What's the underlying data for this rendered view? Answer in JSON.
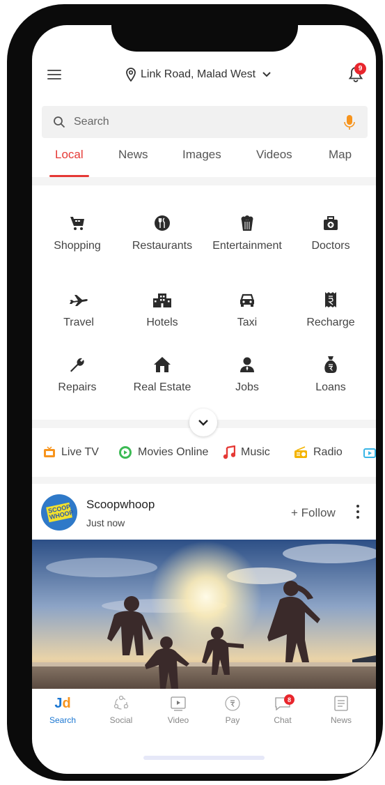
{
  "header": {
    "location": "Link Road, Malad West",
    "notification_count": "9"
  },
  "search": {
    "placeholder": "Search"
  },
  "tabs": [
    {
      "label": "Local"
    },
    {
      "label": "News"
    },
    {
      "label": "Images"
    },
    {
      "label": "Videos"
    },
    {
      "label": "Map"
    }
  ],
  "categories": [
    {
      "label": "Shopping",
      "icon": "shopping-cart-icon"
    },
    {
      "label": "Restaurants",
      "icon": "restaurant-icon"
    },
    {
      "label": "Entertainment",
      "icon": "popcorn-icon"
    },
    {
      "label": "Doctors",
      "icon": "medical-kit-icon"
    },
    {
      "label": "Travel",
      "icon": "airplane-icon"
    },
    {
      "label": "Hotels",
      "icon": "hotel-icon"
    },
    {
      "label": "Taxi",
      "icon": "taxi-icon"
    },
    {
      "label": "Recharge",
      "icon": "receipt-icon"
    },
    {
      "label": "Repairs",
      "icon": "wrench-icon"
    },
    {
      "label": "Real Estate",
      "icon": "house-icon"
    },
    {
      "label": "Jobs",
      "icon": "person-icon"
    },
    {
      "label": "Loans",
      "icon": "money-bag-icon"
    }
  ],
  "media": [
    {
      "label": "Live TV",
      "icon": "tv-icon",
      "color": "#f7941d"
    },
    {
      "label": "Movies Online",
      "icon": "play-circle-icon",
      "color": "#3cba54"
    },
    {
      "label": "Music",
      "icon": "music-note-icon",
      "color": "#e53935"
    },
    {
      "label": "Radio",
      "icon": "radio-icon",
      "color": "#f4b400"
    }
  ],
  "post": {
    "logo_text": "SCOOP WHOOP",
    "name": "Scoopwhoop",
    "time": "Just now",
    "follow_label": "+ Follow"
  },
  "bottom_nav": [
    {
      "label": "Search",
      "logo": "Jd",
      "icon": "jd-logo-icon"
    },
    {
      "label": "Social",
      "icon": "social-icon"
    },
    {
      "label": "Video",
      "icon": "video-icon"
    },
    {
      "label": "Pay",
      "icon": "rupee-icon"
    },
    {
      "label": "Chat",
      "icon": "chat-icon",
      "badge": "8"
    },
    {
      "label": "News",
      "icon": "news-icon"
    }
  ],
  "colors": {
    "accent": "#e53935",
    "brand_blue": "#1a76d2",
    "icon_dark": "#2b2b2b"
  }
}
